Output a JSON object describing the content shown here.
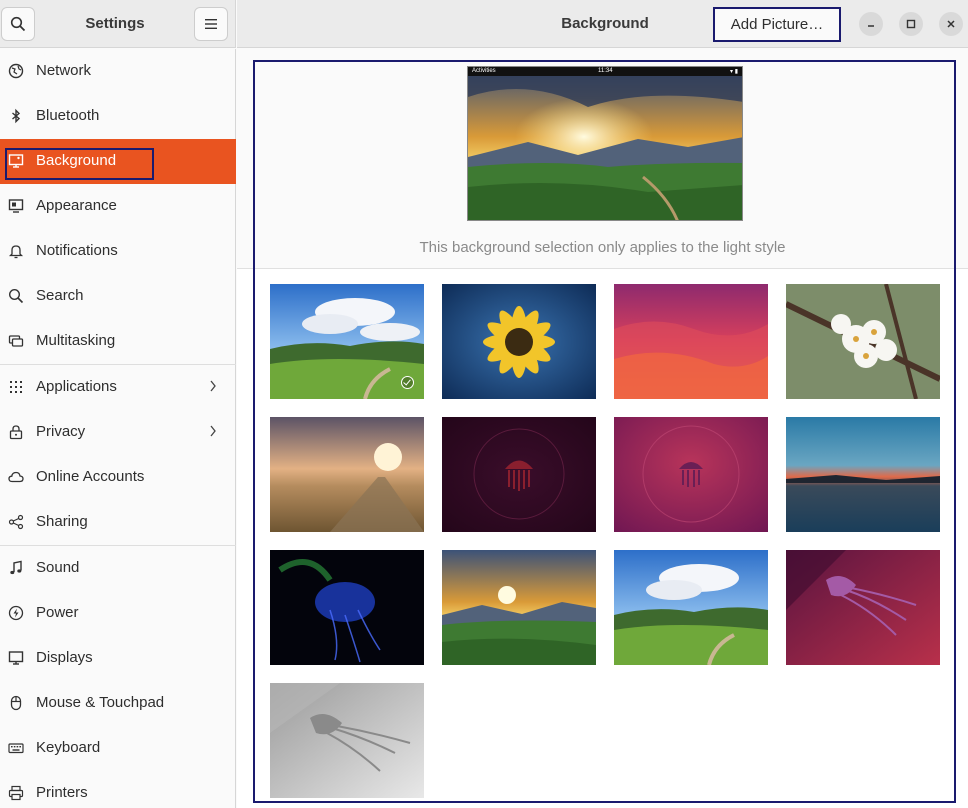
{
  "sidebar": {
    "title": "Settings",
    "items": [
      {
        "label": "Network",
        "icon": "network-icon"
      },
      {
        "label": "Bluetooth",
        "icon": "bluetooth-icon"
      },
      {
        "label": "Background",
        "icon": "background-icon",
        "active": true
      },
      {
        "label": "Appearance",
        "icon": "appearance-icon"
      },
      {
        "label": "Notifications",
        "icon": "bell-icon"
      },
      {
        "label": "Search",
        "icon": "search-icon"
      },
      {
        "label": "Multitasking",
        "icon": "multitasking-icon"
      },
      {
        "label": "Applications",
        "icon": "apps-grid-icon",
        "has_chevron": true
      },
      {
        "label": "Privacy",
        "icon": "lock-icon",
        "has_chevron": true
      },
      {
        "label": "Online Accounts",
        "icon": "cloud-icon"
      },
      {
        "label": "Sharing",
        "icon": "share-icon"
      },
      {
        "label": "Sound",
        "icon": "music-note-icon"
      },
      {
        "label": "Power",
        "icon": "power-icon"
      },
      {
        "label": "Displays",
        "icon": "display-icon"
      },
      {
        "label": "Mouse & Touchpad",
        "icon": "mouse-icon"
      },
      {
        "label": "Keyboard",
        "icon": "keyboard-icon"
      },
      {
        "label": "Printers",
        "icon": "printer-icon"
      }
    ]
  },
  "header": {
    "title": "Background",
    "add_button": "Add Picture…"
  },
  "preview": {
    "topbar_activities": "Activities",
    "topbar_clock": "11:34",
    "note": "This background selection only applies to the light style"
  },
  "wallpapers": [
    {
      "name": "green-valley-clouds",
      "selected": true
    },
    {
      "name": "yellow-flower"
    },
    {
      "name": "pink-purple-waves"
    },
    {
      "name": "white-blossoms"
    },
    {
      "name": "golden-field-sunset"
    },
    {
      "name": "dark-jellyfish"
    },
    {
      "name": "purple-jellyfish"
    },
    {
      "name": "lake-sunset"
    },
    {
      "name": "blue-jellyfish-dark"
    },
    {
      "name": "mountain-sunset"
    },
    {
      "name": "green-valley-clouds-2"
    },
    {
      "name": "purple-jellyfish-art"
    },
    {
      "name": "grey-jellyfish"
    }
  ],
  "colors": {
    "accent": "#e95420",
    "highlight_outline": "#1a1a6e"
  }
}
